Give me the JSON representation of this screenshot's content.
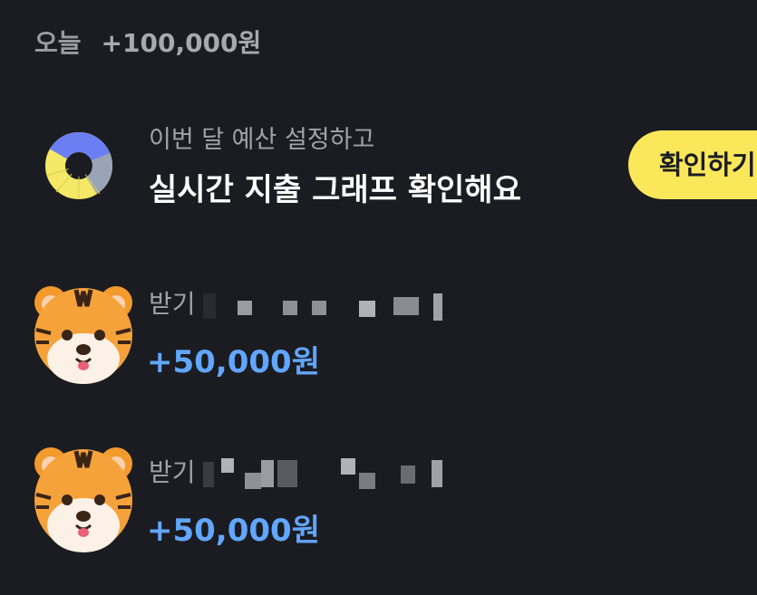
{
  "today": {
    "label": "오늘",
    "total": "+100,000원"
  },
  "budget_promo": {
    "subtitle": "이번 달 예산 설정하고",
    "title": "실시간 지출 그래프 확인해요",
    "button_label": "확인하기",
    "chart_icon": "donut-chart-icon",
    "colors": {
      "blue": "#6b7ff2",
      "yellow": "#f4e866",
      "gray": "#9aa4b8",
      "button_bg": "#fbe85a"
    }
  },
  "transactions": [
    {
      "avatar_icon": "tiger-face-icon",
      "label": "받기",
      "amount": "+50,000원"
    },
    {
      "avatar_icon": "tiger-face-icon",
      "label": "받기",
      "amount": "+50,000원"
    }
  ],
  "theme": {
    "background": "#1b1c21",
    "amount_color": "#61a6ff"
  }
}
